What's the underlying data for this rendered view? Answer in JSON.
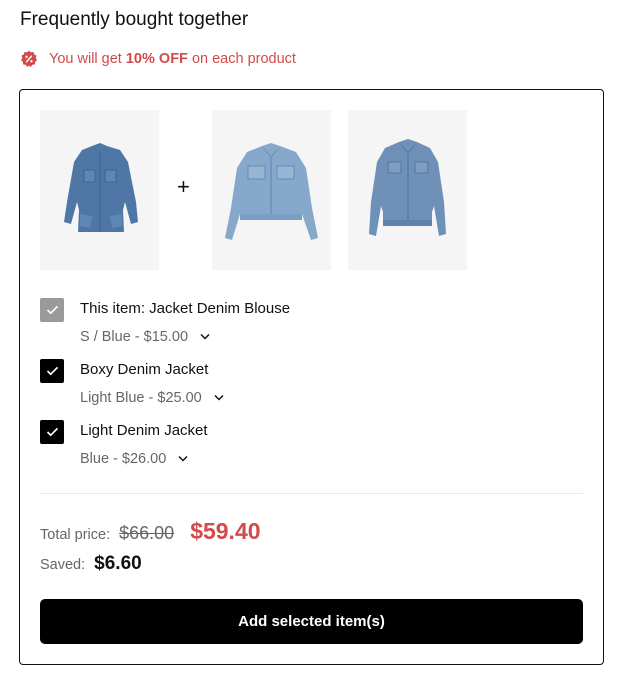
{
  "section": {
    "title": "Frequently bought together"
  },
  "promo": {
    "text_before": "You will get",
    "percent": "10% OFF",
    "text_after": "on each product",
    "color": "#d24a4a"
  },
  "products": [
    {
      "name": "This item: Jacket Denim Blouse",
      "variant": "S / Blue - $15.00",
      "checked": true,
      "current_item": true
    },
    {
      "name": "Boxy Denim Jacket",
      "variant": "Light Blue - $25.00",
      "checked": true,
      "current_item": false
    },
    {
      "name": "Light Denim Jacket",
      "variant": "Blue - $26.00",
      "checked": true,
      "current_item": false
    }
  ],
  "plus_sign": "+",
  "totals": {
    "total_label": "Total price:",
    "original_price": "$66.00",
    "discounted_price": "$59.40",
    "saved_label": "Saved:",
    "saved_amount": "$6.60"
  },
  "button": {
    "label": "Add selected item(s)"
  },
  "colors": {
    "accent_red": "#d24a4a",
    "button_bg": "#000000",
    "checkbox_on": "#000000",
    "checkbox_disabled": "#9a9a9a"
  }
}
